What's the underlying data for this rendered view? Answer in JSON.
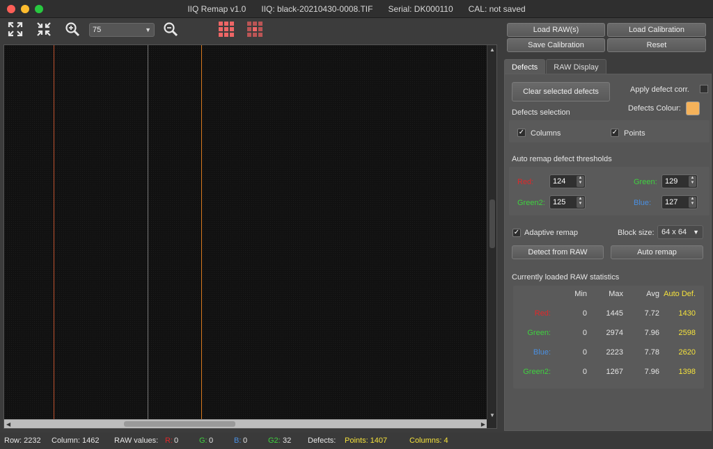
{
  "window": {
    "app_title": "IIQ Remap v1.0",
    "file": "IIQ: black-20210430-0008.TIF",
    "serial": "Serial: DK000110",
    "cal": "CAL: not saved"
  },
  "toolbar": {
    "zoom_value": "75",
    "icons": [
      "expand-icon",
      "collapse-icon",
      "zoom-in-icon",
      "zoom-out-icon",
      "grid-all-icon",
      "grid-center-icon"
    ]
  },
  "actions": {
    "load_raw": "Load RAW(s)",
    "load_calibration": "Load Calibration",
    "save_calibration": "Save Calibration",
    "reset": "Reset"
  },
  "tabs": [
    {
      "label": "Defects",
      "active": true
    },
    {
      "label": "RAW Display",
      "active": false
    }
  ],
  "defects": {
    "clear_selected": "Clear selected defects",
    "apply_corr": "Apply defect corr.",
    "defects_colour_label": "Defects Colour:",
    "defects_colour": "#f5b25a",
    "selection_title": "Defects selection",
    "columns_label": "Columns",
    "columns_checked": true,
    "points_label": "Points",
    "points_checked": true
  },
  "thresholds": {
    "title": "Auto remap defect thresholds",
    "red_label": "Red:",
    "red_value": "124",
    "green_label": "Green:",
    "green_value": "129",
    "green2_label": "Green2:",
    "green2_value": "125",
    "blue_label": "Blue:",
    "blue_value": "127"
  },
  "remap": {
    "adaptive_label": "Adaptive remap",
    "adaptive_checked": true,
    "block_size_label": "Block size:",
    "block_size_value": "64 x 64",
    "detect_button": "Detect from RAW",
    "auto_remap_button": "Auto remap"
  },
  "stats": {
    "title": "Currently loaded RAW statistics",
    "headers": [
      "Min",
      "Max",
      "Avg",
      "Auto Def."
    ],
    "rows": [
      {
        "channel": "Red:",
        "min": "0",
        "max": "1445",
        "avg": "7.72",
        "auto": "1430"
      },
      {
        "channel": "Green:",
        "min": "0",
        "max": "2974",
        "avg": "7.96",
        "auto": "2598"
      },
      {
        "channel": "Blue:",
        "min": "0",
        "max": "2223",
        "avg": "7.78",
        "auto": "2620"
      },
      {
        "channel": "Green2:",
        "min": "0",
        "max": "1267",
        "avg": "7.96",
        "auto": "1398"
      }
    ]
  },
  "colors": {
    "red": "#e0282a",
    "green": "#3fd23f",
    "blue": "#4a90e2",
    "yellow": "#f5e23c",
    "orange_line": "#d97a20"
  },
  "status": {
    "row": "Row: 2232",
    "column": "Column: 1462",
    "raw_values": "RAW values:",
    "r_label": "R:",
    "r_value": "0",
    "g_label": "G:",
    "g_value": "0",
    "b_label": "B:",
    "b_value": "0",
    "g2_label": "G2:",
    "g2_value": "32",
    "defects": "Defects:",
    "points": "Points: 1407",
    "columns": "Columns: 4"
  }
}
